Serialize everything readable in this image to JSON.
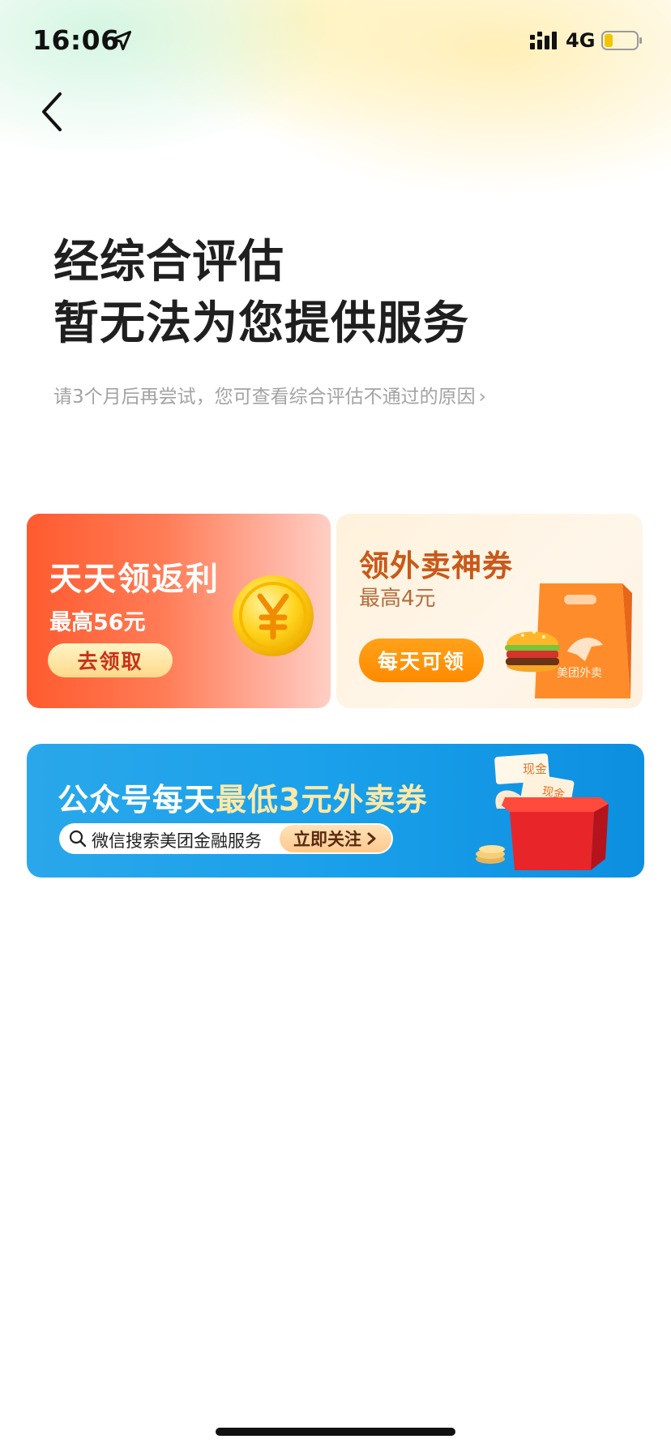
{
  "status_bar": {
    "time": "16:06",
    "network": "4G"
  },
  "header": {
    "title_line1": "经综合评估",
    "title_line2": "暂无法为您提供服务",
    "subtitle": "请3个月后再尝试，您可查看综合评估不通过的原因",
    "subtitle_chevron": "›"
  },
  "cards": {
    "rebate": {
      "title": "天天领返利",
      "subtitle": "最高56元",
      "button": "去领取"
    },
    "coupon": {
      "title": "领外卖神券",
      "subtitle": "最高4元",
      "button": "每天可领",
      "bag_text": "美团外卖"
    }
  },
  "banner": {
    "title_part1": "公众号每天",
    "title_part2": "最低3元外卖券",
    "search_text": "微信搜索美团金融服务",
    "follow_button": "立即关注",
    "tag1": "现金",
    "tag2": "现金"
  },
  "colors": {
    "rebate_card": "#ff5a2f",
    "coupon_button": "#ff8a00",
    "banner": "#1aa0ea"
  },
  "icons": [
    "location-arrow-icon",
    "signal-icon",
    "battery-icon",
    "back-chevron-icon",
    "coin-icon",
    "bag-icon",
    "burger-icon",
    "search-icon",
    "gift-box-icon"
  ]
}
